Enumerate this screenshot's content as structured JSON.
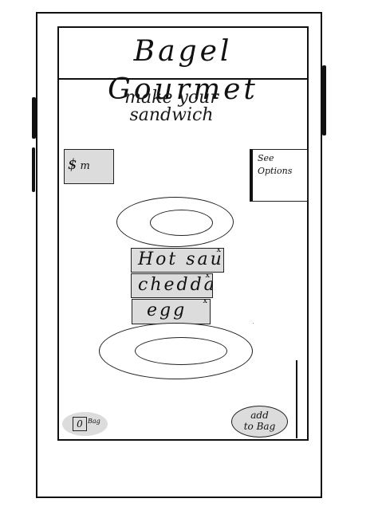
{
  "app": {
    "title": "Bagel Gourmet"
  },
  "main": {
    "subtitle_line1": "make your",
    "subtitle_line2": "sandwich",
    "price": {
      "symbol": "$",
      "value": "m"
    },
    "options_button": {
      "line1": "See",
      "line2": "Options"
    }
  },
  "ingredients": [
    {
      "label": "Hot sauce",
      "remove": "x"
    },
    {
      "label": "cheddar",
      "remove": "x"
    },
    {
      "label": "egg",
      "remove": "x"
    }
  ],
  "footer": {
    "bag_count": "0",
    "bag_label": "Bag",
    "add_line1": "add",
    "add_line2": "to Bag"
  },
  "colors": {
    "fill_gray": "#dcdcdc",
    "stroke": "#111111",
    "background": "#ffffff"
  }
}
